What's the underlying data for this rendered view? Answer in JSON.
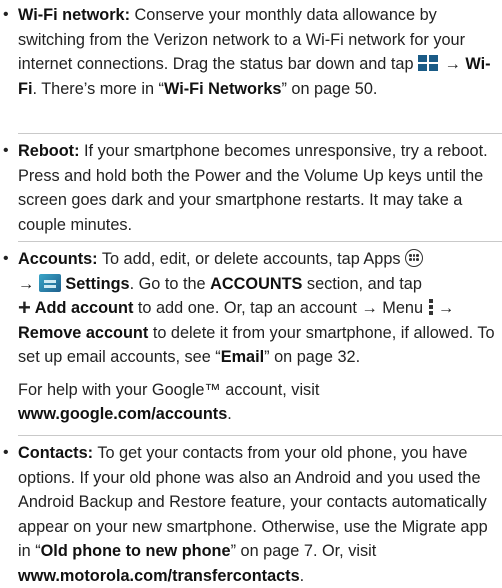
{
  "items": [
    {
      "title": "Wi-Fi network:",
      "text1": " Conserve your monthly data allowance by switching from the Verizon network to a Wi-Fi network for your internet connections. Drag the status bar down and tap ",
      "arrow1": " → ",
      "wifi_label": "Wi-Fi",
      "text2": ". There’s more in “",
      "link": "Wi-Fi Networks",
      "text3": "” on page 50."
    },
    {
      "title": "Reboot:",
      "text1": " If your smartphone becomes unresponsive, try a reboot. Press and hold both the Power and the Volume Up keys until the screen goes dark and your smartphone restarts. It may take a couple minutes."
    },
    {
      "title": "Accounts:",
      "text1": " To add, edit, or delete accounts, tap Apps ",
      "arrow1": " → ",
      "settings_label": "Settings",
      "text2": ". Go to the ",
      "accounts_section": "ACCOUNTS",
      "text3": " section, and tap ",
      "add_account": " Add account",
      "text4": " to add one. Or, tap an account → Menu ",
      "arrow2": " → ",
      "remove_account": "Remove account",
      "text5": " to delete it from your smartphone, if allowed. To set up email accounts, see “",
      "email_link": "Email",
      "text6": "” on page 32.",
      "para2_text": "For help with your Google™ account, visit ",
      "google_url": "www.google.com/accounts",
      "para2_end": "."
    },
    {
      "title": "Contacts:",
      "text1": " To get your contacts from your old phone, you have options. If your old phone was also an Android and you used the Android Backup and Restore feature, your contacts automatically appear on your new smartphone. Otherwise, use the Migrate app in “",
      "link": "Old phone to new phone",
      "text2": "” on page 7. Or, visit ",
      "url": "www.motorola.com/transfercontacts",
      "text3": "."
    }
  ],
  "bullet_char": "•",
  "plus_char": "+"
}
